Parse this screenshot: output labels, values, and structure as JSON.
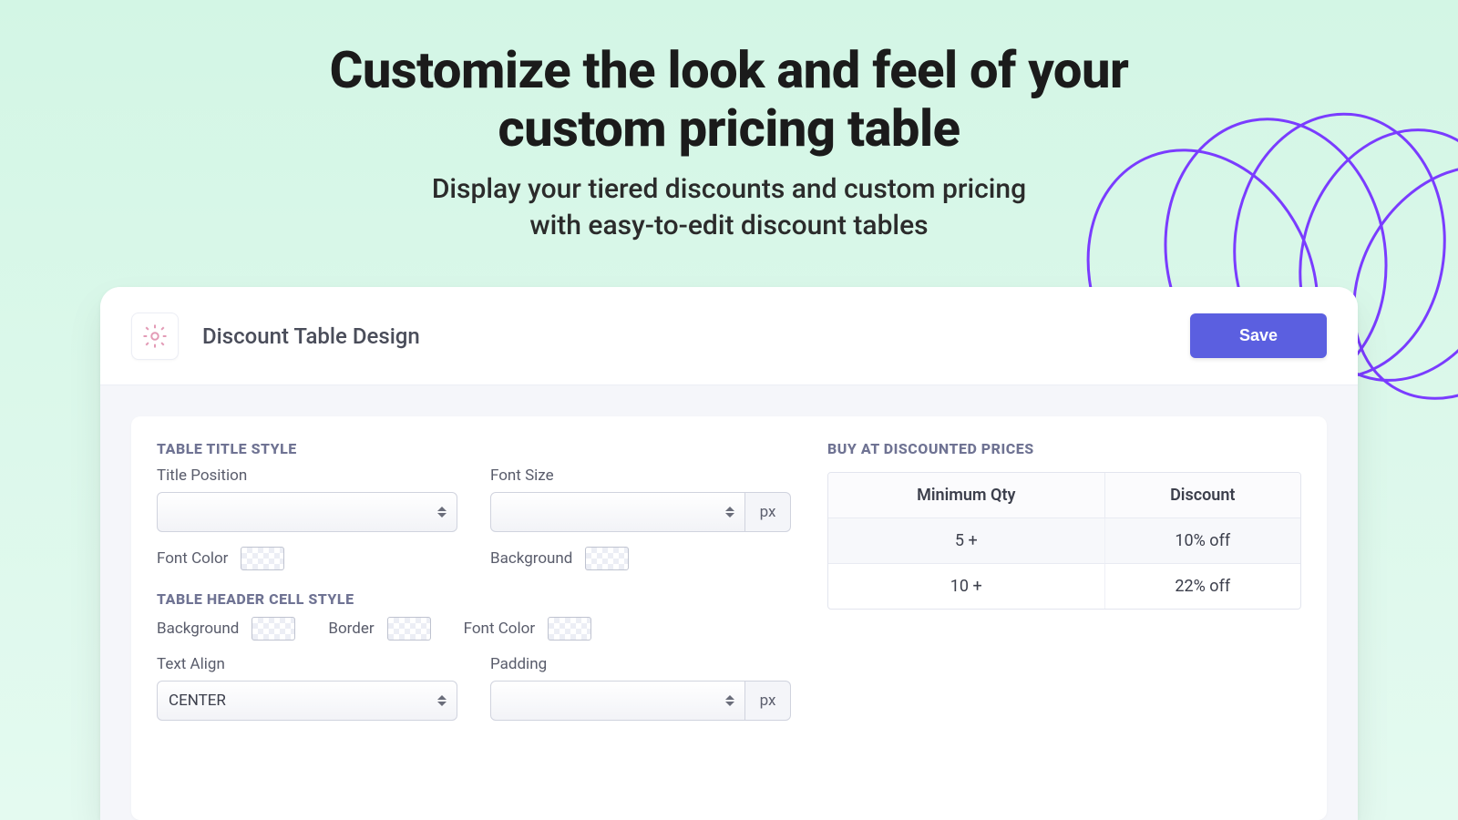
{
  "hero": {
    "title_line1": "Customize the look and feel of your",
    "title_line2": "custom pricing table",
    "subtitle_line1": "Display your tiered discounts and custom pricing",
    "subtitle_line2": "with easy-to-edit discount tables"
  },
  "header": {
    "title": "Discount Table Design",
    "save_label": "Save"
  },
  "sections": {
    "title_style": {
      "label": "TABLE TITLE STYLE",
      "title_position_label": "Title Position",
      "title_position_value": "",
      "font_size_label": "Font Size",
      "font_size_value": "",
      "font_size_unit": "px",
      "font_color_label": "Font Color",
      "background_label": "Background"
    },
    "header_cell_style": {
      "label": "TABLE HEADER CELL STYLE",
      "background_label": "Background",
      "border_label": "Border",
      "font_color_label": "Font Color",
      "text_align_label": "Text Align",
      "text_align_value": "CENTER",
      "padding_label": "Padding",
      "padding_value": "",
      "padding_unit": "px"
    }
  },
  "preview": {
    "title": "BUY AT DISCOUNTED PRICES",
    "col_qty": "Minimum Qty",
    "col_disc": "Discount",
    "rows": [
      {
        "qty": "5 +",
        "disc": "10% off"
      },
      {
        "qty": "10 +",
        "disc": "22% off"
      }
    ]
  }
}
